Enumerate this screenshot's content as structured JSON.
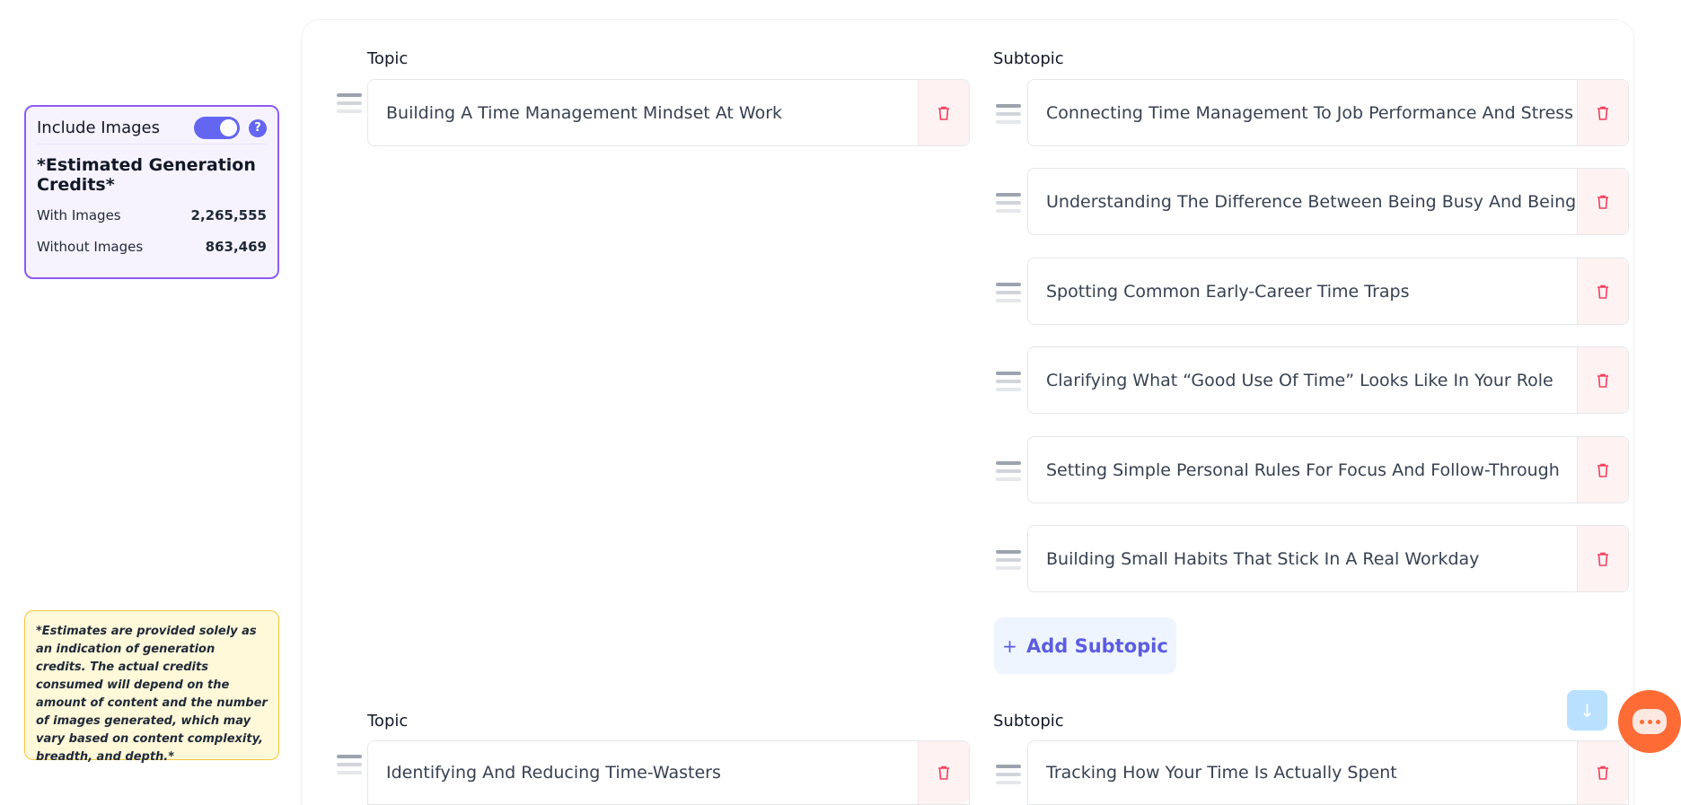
{
  "credits": {
    "include_images_label": "Include Images",
    "include_images_on": true,
    "help_glyph": "?",
    "estimated_title": "*Estimated Generation Credits*",
    "with_images_label": "With Images",
    "with_images_value": "2,265,555",
    "without_images_label": "Without Images",
    "without_images_value": "863,469"
  },
  "disclaimer": "*Estimates are provided solely as an indication of generation credits. The actual credits consumed will depend on the amount of content and the number of images generated, which may vary based on content complexity, breadth, and depth.*",
  "sections": [
    {
      "topic_label": "Topic",
      "subtopic_label": "Subtopic",
      "topic": "Building A Time Management Mindset At Work",
      "subtopics": [
        "Connecting Time Management To Job Performance And Stress",
        "Understanding The Difference Between Being Busy And Being Productive",
        "Spotting Common Early-Career Time Traps",
        "Clarifying What “Good Use Of Time” Looks Like In Your Role",
        "Setting Simple Personal Rules For Focus And Follow-Through",
        "Building Small Habits That Stick In A Real Workday"
      ],
      "add_subtopic_label": "Add Subtopic"
    },
    {
      "topic_label": "Topic",
      "subtopic_label": "Subtopic",
      "topic": "Identifying And Reducing Time-Wasters",
      "subtopics": [
        "Tracking How Your Time Is Actually Spent"
      ]
    }
  ],
  "icons": {
    "delete": "trash-icon",
    "drag": "drag-handle-icon",
    "scroll": "arrow-down-icon",
    "chat": "chat-icon"
  },
  "colors": {
    "accent": "#6366f1",
    "panel_border": "#8b5cf6",
    "delete": "#f43f5e",
    "chat": "#ff6b35",
    "disclaimer_bg": "#fff8d9"
  }
}
